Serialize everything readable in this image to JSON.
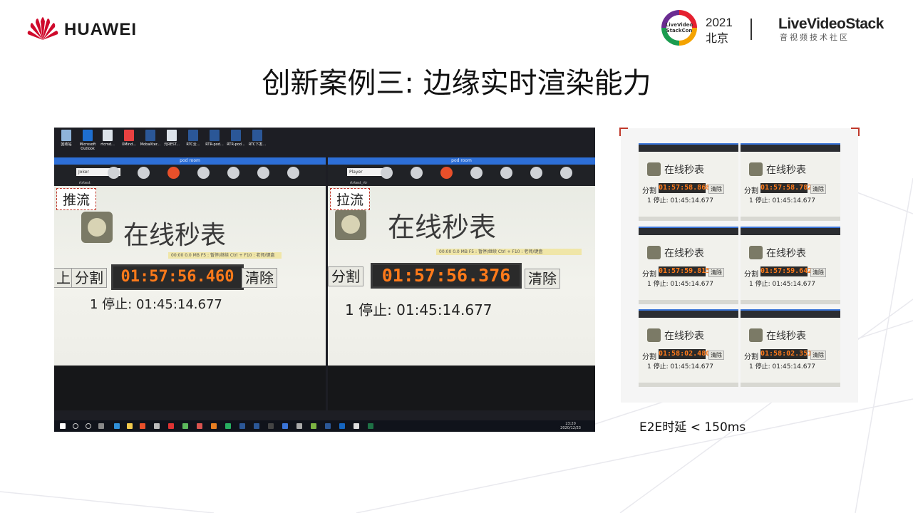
{
  "header": {
    "brand": "HUAWEI",
    "conference": {
      "badge_text": "LiveVideo StackCon",
      "year": "2021",
      "city": "北京"
    },
    "community": {
      "brand": "LiveVideoStack",
      "subtitle": "音视频技术社区"
    }
  },
  "slide_title": "创新案例三: 边缘实时渲染能力",
  "screenshot": {
    "desktop_icons": [
      "回收站",
      "Microsoft Outlook",
      "rtcmd...",
      "XMind...",
      "MobaXter...",
      "元REST...",
      "RTC云...",
      "RTR-pod...",
      "RTR-pod...",
      "RTC下发..."
    ],
    "windows": [
      {
        "title": "pod room",
        "selector": "Joker",
        "sub": "rtrtest",
        "label": "推流",
        "app_title": "在线秒表",
        "split": "分割",
        "left_cut": "上",
        "timer": "01:57:56.460",
        "clear": "清除",
        "stop": "1 停止: 01:45:14.677",
        "mini_bar": "00:00   0.0 MB   F5 : 暂停/继续  Ctrl + F10 : 老师/键盘"
      },
      {
        "title": "pod room",
        "selector": "Player",
        "sub": "rtrtest_rtr",
        "label": "拉流",
        "app_title": "在线秒表",
        "split": "分割",
        "timer": "01:57:56.376",
        "clear": "清除",
        "stop": "1 停止: 01:45:14.677",
        "mini_bar": "00:00   0.0 MB   F5 : 暂停/继续  Ctrl + F10 : 老师/键盘"
      }
    ],
    "taskbar": {
      "time": "23:20",
      "date": "2020/12/23"
    }
  },
  "comparison_panel": {
    "thumbs": [
      {
        "title": "在线秒表",
        "split": "分割",
        "timer": "01:57:58.868",
        "clear": "清除",
        "stop": "1 停止: 01:45:14.677"
      },
      {
        "title": "在线秒表",
        "split": "分割",
        "timer": "01:57:58.782",
        "clear": "清除",
        "stop": "1 停止: 01:45:14.677"
      },
      {
        "title": "在线秒表",
        "split": "分割",
        "timer": "01:57:59.815",
        "clear": "清除",
        "stop": "1 停止: 01:45:14.677"
      },
      {
        "title": "在线秒表",
        "split": "分割",
        "timer": "01:57:59.642",
        "clear": "清除",
        "stop": "1 停止: 01:45:14.677"
      },
      {
        "title": "在线秒表",
        "split": "分割",
        "timer": "01:58:02.480",
        "clear": "清除",
        "stop": "1 停止: 01:45:14.677"
      },
      {
        "title": "在线秒表",
        "split": "分割",
        "timer": "01:58:02.351",
        "clear": "清除",
        "stop": "1 停止: 01:45:14.677"
      }
    ]
  },
  "caption": "E2E时延 < 150ms",
  "colors": {
    "accent_red": "#c0392b",
    "timer_orange": "#ff7a1a",
    "window_blue": "#2d6fd7"
  }
}
